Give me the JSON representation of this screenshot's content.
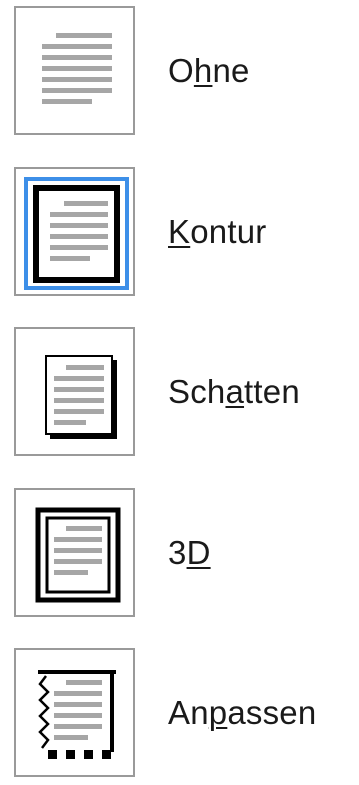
{
  "border_options": [
    {
      "id": "ohne",
      "label_pre": "O",
      "label_access": "h",
      "label_post": "ne",
      "icon": "border-none-icon",
      "selected": false
    },
    {
      "id": "kontur",
      "label_pre": "",
      "label_access": "K",
      "label_post": "ontur",
      "icon": "border-box-icon",
      "selected": true
    },
    {
      "id": "schatten",
      "label_pre": "Sch",
      "label_access": "a",
      "label_post": "tten",
      "icon": "border-shadow-icon",
      "selected": false
    },
    {
      "id": "3d",
      "label_pre": "3",
      "label_access": "D",
      "label_post": "",
      "icon": "border-3d-icon",
      "selected": false
    },
    {
      "id": "anpassen",
      "label_pre": "An",
      "label_access": "p",
      "label_post": "assen",
      "icon": "border-custom-icon",
      "selected": false
    }
  ],
  "colors": {
    "tile_border": "#9a9a9a",
    "selection_ring": "#3d8fe8",
    "text_lines": "#a6a6a6",
    "frame": "#000000",
    "label_text": "#1a1a1a"
  }
}
